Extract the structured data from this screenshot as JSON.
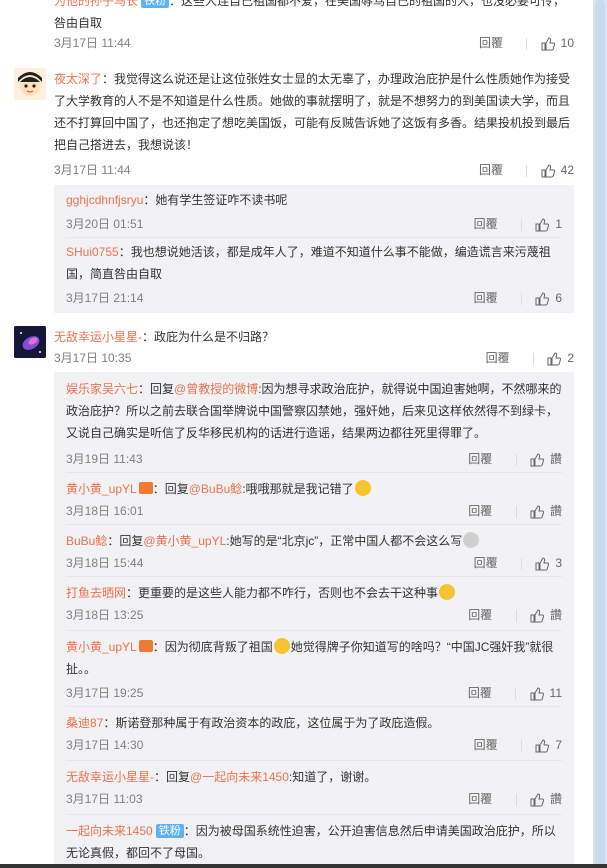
{
  "comments": {
    "top_partial": {
      "author_fragment": "为他的孙子马长",
      "text_line1": "：这些人连自己祖国都不爱，在美国辱骂自己的祖国的人，也没必要可怜，咎由自取",
      "text_fragment": "他的祖国的人，也没必要可怜，咎由自取",
      "time": "3月17日 11:44",
      "reply_label": "回覆",
      "likes": "10"
    },
    "c1": {
      "author": "夜太深了",
      "text": "：我觉得这么说还是让这位张姓女士显的太无辜了，办理政治庇护是什么性质她作为接受了大学教育的人不是不知道是什么性质。她做的事就摆明了，就是不想努力的到美国读大学，而且还不打算回中国了，也还抱定了想吃美国饭，可能有反贼告诉她了这饭有多香。结果投机投到最后把自己搭进去，我想说该！",
      "time": "3月17日 11:44",
      "reply_label": "回覆",
      "likes": "42",
      "replies": [
        {
          "author": "gghjcdhnfjsryu",
          "text": "：她有学生签证咋不读书呢",
          "time": "3月20日 01:51",
          "reply_label": "回覆",
          "likes": "1"
        },
        {
          "author": "SHui0755",
          "text": "：我也想说她活该，都是成年人了，难道不知道什么事不能做，编造谎言来污蔑祖国，简直咎由自取",
          "time": "3月17日 21:14",
          "reply_label": "回覆",
          "likes": "6"
        }
      ]
    },
    "c2": {
      "author": "无敌幸运小星星-",
      "text": "：政庇为什么是不归路？",
      "time": "3月17日 10:35",
      "reply_label": "回覆",
      "likes": "2",
      "replies": [
        {
          "author": "娱乐家吴六七",
          "prefix": "：回复",
          "mention": "@曾教授的微博",
          "text": ":因为想寻求政治庇护，就得说中国迫害她啊，不然哪来的政治庇护？所以之前去联合国举牌说中国警察囚禁她，强奸她，后来见这样依然得不到绿卡，又说自己确实是听信了反华移民机构的话进行造谣，结果两边都往死里得罪了。",
          "time": "3月19日 11:43",
          "reply_label": "回覆",
          "likes": "讚"
        },
        {
          "author": "黄小黄_upYL",
          "prefix": "：回复",
          "mention": "@BuBu鲶",
          "text": ":哦哦那就是我记错了",
          "time": "3月18日 16:01",
          "reply_label": "回覆",
          "likes": "讚"
        },
        {
          "author": "BuBu鲶",
          "prefix": "：回复",
          "mention": "@黄小黄_upYL",
          "text": ":她写的是“北京jc”，正常中国人都不会这么写",
          "time": "3月18日 15:44",
          "reply_label": "回覆",
          "likes": "3"
        },
        {
          "author": "打鱼去晒网",
          "text": "：更重要的是这些人能力都不咋行，否则也不会去干这种事",
          "time": "3月18日 13:25",
          "reply_label": "回覆",
          "likes": "讚"
        },
        {
          "author": "黄小黄_upYL",
          "text": "：因为彻底背叛了祖国",
          "text2": "她觉得牌子你知道写的啥吗？“中国JC强奸我”就很扯。。",
          "time": "3月17日 19:25",
          "reply_label": "回覆",
          "likes": "11"
        },
        {
          "author": "桑迪87",
          "text": "：斯诺登那种属于有政治资本的政庇，这位属于为了政庇造假。",
          "time": "3月17日 14:30",
          "reply_label": "回覆",
          "likes": "7"
        },
        {
          "author": "无敌幸运小星星-",
          "prefix": "：回复",
          "mention": "@一起向未来1450",
          "text": ":知道了，谢谢。",
          "time": "3月17日 11:03",
          "reply_label": "回覆",
          "likes": "讚"
        },
        {
          "author": "一起向未来1450",
          "badge": "铁粉",
          "text": "：因为被母国系统性迫害，公开迫害信息然后申请美国政治庇护，所以无论真假，都回不了母国。"
        }
      ]
    }
  },
  "colors": {
    "author": "#eb7350",
    "text": "#333333",
    "meta": "#808080",
    "sub_bg": "#f2f2f5"
  }
}
